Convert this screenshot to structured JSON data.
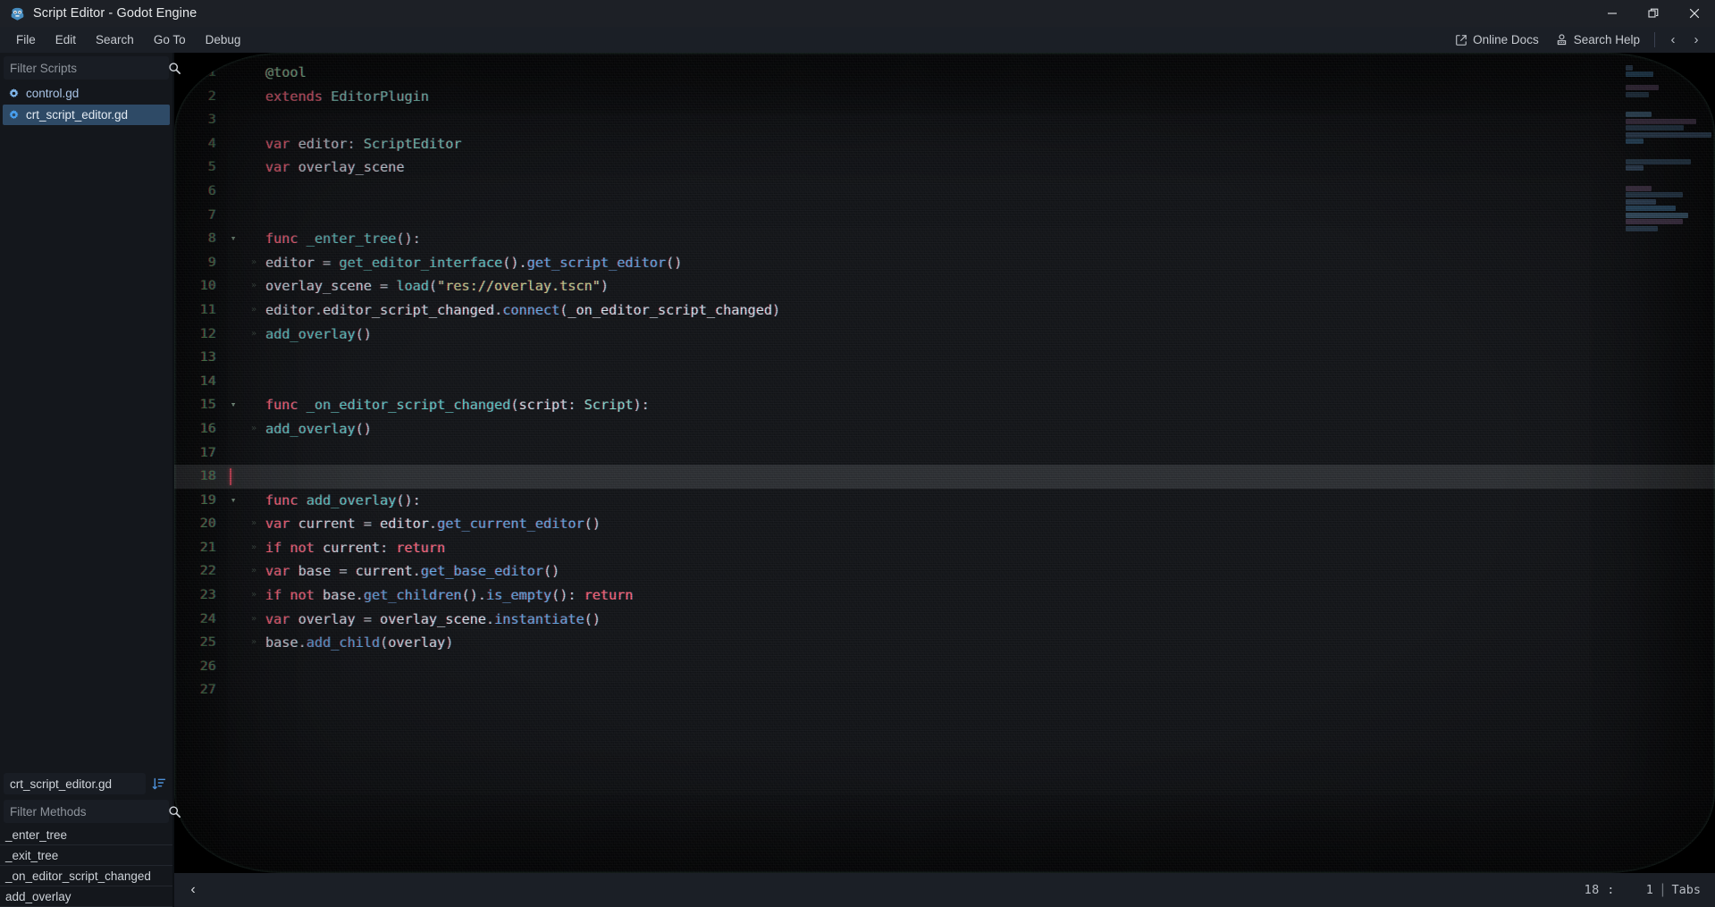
{
  "window": {
    "title": "Script Editor - Godot Engine",
    "app_icon": "godot-logo-icon",
    "controls": {
      "minimize": "minimize-icon",
      "restore": "restore-icon",
      "close": "close-icon"
    }
  },
  "menubar": {
    "items": [
      {
        "label": "File"
      },
      {
        "label": "Edit"
      },
      {
        "label": "Search"
      },
      {
        "label": "Go To"
      },
      {
        "label": "Debug"
      }
    ],
    "right": {
      "online_docs": "Online Docs",
      "search_help": "Search Help",
      "nav_prev": "‹",
      "nav_next": "›"
    }
  },
  "sidebar": {
    "filter_scripts": {
      "placeholder": "Filter Scripts",
      "value": "",
      "icon": "search-icon"
    },
    "scripts": [
      {
        "name": "control.gd",
        "icon": "gear-icon",
        "selected": false
      },
      {
        "name": "crt_script_editor.gd",
        "icon": "gear-icon",
        "selected": true
      }
    ],
    "current_file": "crt_script_editor.gd",
    "sort_button": "sort-icon",
    "filter_methods": {
      "placeholder": "Filter Methods",
      "value": "",
      "icon": "search-icon"
    },
    "methods": [
      {
        "name": "_enter_tree"
      },
      {
        "name": "_exit_tree"
      },
      {
        "name": "_on_editor_script_changed"
      },
      {
        "name": "add_overlay"
      }
    ]
  },
  "editor": {
    "active_line": 18,
    "lines": [
      {
        "n": 1,
        "fold": "",
        "guide": "",
        "tokens": [
          {
            "t": "annot",
            "s": "@tool"
          }
        ]
      },
      {
        "n": 2,
        "fold": "",
        "guide": "",
        "tokens": [
          {
            "t": "kw",
            "s": "extends"
          },
          {
            "t": "punc",
            "s": " "
          },
          {
            "t": "type",
            "s": "EditorPlugin"
          }
        ]
      },
      {
        "n": 3,
        "fold": "",
        "guide": "",
        "tokens": []
      },
      {
        "n": 4,
        "fold": "",
        "guide": "",
        "tokens": [
          {
            "t": "kw",
            "s": "var"
          },
          {
            "t": "punc",
            "s": " "
          },
          {
            "t": "var",
            "s": "editor"
          },
          {
            "t": "punc",
            "s": ": "
          },
          {
            "t": "type",
            "s": "ScriptEditor"
          }
        ]
      },
      {
        "n": 5,
        "fold": "",
        "guide": "",
        "tokens": [
          {
            "t": "kw",
            "s": "var"
          },
          {
            "t": "punc",
            "s": " "
          },
          {
            "t": "var",
            "s": "overlay_scene"
          }
        ]
      },
      {
        "n": 6,
        "fold": "",
        "guide": "",
        "tokens": []
      },
      {
        "n": 7,
        "fold": "",
        "guide": "",
        "tokens": []
      },
      {
        "n": 8,
        "fold": "v",
        "guide": "",
        "tokens": [
          {
            "t": "kw",
            "s": "func"
          },
          {
            "t": "punc",
            "s": " "
          },
          {
            "t": "fn",
            "s": "_enter_tree"
          },
          {
            "t": "punc",
            "s": "():"
          }
        ]
      },
      {
        "n": 9,
        "fold": "",
        "guide": "»",
        "tokens": [
          {
            "t": "var",
            "s": "editor"
          },
          {
            "t": "punc",
            "s": " = "
          },
          {
            "t": "fn",
            "s": "get_editor_interface"
          },
          {
            "t": "punc",
            "s": "()."
          },
          {
            "t": "member",
            "s": "get_script_editor"
          },
          {
            "t": "punc",
            "s": "()"
          }
        ]
      },
      {
        "n": 10,
        "fold": "",
        "guide": "»",
        "tokens": [
          {
            "t": "var",
            "s": "overlay_scene"
          },
          {
            "t": "punc",
            "s": " = "
          },
          {
            "t": "fn",
            "s": "load"
          },
          {
            "t": "punc",
            "s": "("
          },
          {
            "t": "str",
            "s": "\"res://overlay.tscn\""
          },
          {
            "t": "punc",
            "s": ")"
          }
        ]
      },
      {
        "n": 11,
        "fold": "",
        "guide": "»",
        "tokens": [
          {
            "t": "var",
            "s": "editor"
          },
          {
            "t": "punc",
            "s": "."
          },
          {
            "t": "var",
            "s": "editor_script_changed"
          },
          {
            "t": "punc",
            "s": "."
          },
          {
            "t": "member",
            "s": "connect"
          },
          {
            "t": "punc",
            "s": "("
          },
          {
            "t": "var",
            "s": "_on_editor_script_changed"
          },
          {
            "t": "punc",
            "s": ")"
          }
        ]
      },
      {
        "n": 12,
        "fold": "",
        "guide": "»",
        "tokens": [
          {
            "t": "fn",
            "s": "add_overlay"
          },
          {
            "t": "punc",
            "s": "()"
          }
        ]
      },
      {
        "n": 13,
        "fold": "",
        "guide": "",
        "tokens": []
      },
      {
        "n": 14,
        "fold": "",
        "guide": "",
        "tokens": []
      },
      {
        "n": 15,
        "fold": "v",
        "guide": "",
        "tokens": [
          {
            "t": "kw",
            "s": "func"
          },
          {
            "t": "punc",
            "s": " "
          },
          {
            "t": "fn",
            "s": "_on_editor_script_changed"
          },
          {
            "t": "punc",
            "s": "("
          },
          {
            "t": "var",
            "s": "script"
          },
          {
            "t": "punc",
            "s": ": "
          },
          {
            "t": "type",
            "s": "Script"
          },
          {
            "t": "punc",
            "s": "):"
          }
        ]
      },
      {
        "n": 16,
        "fold": "",
        "guide": "»",
        "tokens": [
          {
            "t": "fn",
            "s": "add_overlay"
          },
          {
            "t": "punc",
            "s": "()"
          }
        ]
      },
      {
        "n": 17,
        "fold": "",
        "guide": "",
        "tokens": []
      },
      {
        "n": 18,
        "fold": "",
        "guide": "",
        "tokens": []
      },
      {
        "n": 19,
        "fold": "v",
        "guide": "",
        "tokens": [
          {
            "t": "kw",
            "s": "func"
          },
          {
            "t": "punc",
            "s": " "
          },
          {
            "t": "fn",
            "s": "add_overlay"
          },
          {
            "t": "punc",
            "s": "():"
          }
        ]
      },
      {
        "n": 20,
        "fold": "",
        "guide": "»",
        "tokens": [
          {
            "t": "kw",
            "s": "var"
          },
          {
            "t": "punc",
            "s": " "
          },
          {
            "t": "var",
            "s": "current"
          },
          {
            "t": "punc",
            "s": " = "
          },
          {
            "t": "var",
            "s": "editor"
          },
          {
            "t": "punc",
            "s": "."
          },
          {
            "t": "member",
            "s": "get_current_editor"
          },
          {
            "t": "punc",
            "s": "()"
          }
        ]
      },
      {
        "n": 21,
        "fold": "",
        "guide": "»",
        "tokens": [
          {
            "t": "kw",
            "s": "if"
          },
          {
            "t": "punc",
            "s": " "
          },
          {
            "t": "kw",
            "s": "not"
          },
          {
            "t": "punc",
            "s": " "
          },
          {
            "t": "var",
            "s": "current"
          },
          {
            "t": "punc",
            "s": ": "
          },
          {
            "t": "kw",
            "s": "return"
          }
        ]
      },
      {
        "n": 22,
        "fold": "",
        "guide": "»",
        "tokens": [
          {
            "t": "kw",
            "s": "var"
          },
          {
            "t": "punc",
            "s": " "
          },
          {
            "t": "var",
            "s": "base"
          },
          {
            "t": "punc",
            "s": " = "
          },
          {
            "t": "var",
            "s": "current"
          },
          {
            "t": "punc",
            "s": "."
          },
          {
            "t": "member",
            "s": "get_base_editor"
          },
          {
            "t": "punc",
            "s": "()"
          }
        ]
      },
      {
        "n": 23,
        "fold": "",
        "guide": "»",
        "tokens": [
          {
            "t": "kw",
            "s": "if"
          },
          {
            "t": "punc",
            "s": " "
          },
          {
            "t": "kw",
            "s": "not"
          },
          {
            "t": "punc",
            "s": " "
          },
          {
            "t": "var",
            "s": "base"
          },
          {
            "t": "punc",
            "s": "."
          },
          {
            "t": "member",
            "s": "get_children"
          },
          {
            "t": "punc",
            "s": "()."
          },
          {
            "t": "member",
            "s": "is_empty"
          },
          {
            "t": "punc",
            "s": "(): "
          },
          {
            "t": "kw",
            "s": "return"
          }
        ]
      },
      {
        "n": 24,
        "fold": "",
        "guide": "»",
        "tokens": [
          {
            "t": "kw",
            "s": "var"
          },
          {
            "t": "punc",
            "s": " "
          },
          {
            "t": "var",
            "s": "overlay"
          },
          {
            "t": "punc",
            "s": " = "
          },
          {
            "t": "var",
            "s": "overlay_scene"
          },
          {
            "t": "punc",
            "s": "."
          },
          {
            "t": "member",
            "s": "instantiate"
          },
          {
            "t": "punc",
            "s": "()"
          }
        ]
      },
      {
        "n": 25,
        "fold": "",
        "guide": "»",
        "tokens": [
          {
            "t": "var",
            "s": "base"
          },
          {
            "t": "punc",
            "s": "."
          },
          {
            "t": "member",
            "s": "add_child"
          },
          {
            "t": "punc",
            "s": "("
          },
          {
            "t": "var",
            "s": "overlay"
          },
          {
            "t": "punc",
            "s": ")"
          }
        ]
      },
      {
        "n": 26,
        "fold": "",
        "guide": "",
        "tokens": []
      },
      {
        "n": 27,
        "fold": "",
        "guide": "",
        "tokens": []
      }
    ]
  },
  "statusbar": {
    "back_button": "‹",
    "line": "18",
    "colon": ":",
    "column": "1",
    "separator": "|",
    "indent_mode": "Tabs"
  },
  "colors": {
    "accent": "#4d90d8",
    "selected_row": "#2e4a66",
    "keyword": "#ff6b7e",
    "function": "#63d0c8",
    "string": "#c8d08a",
    "linenumber": "#4e7f50",
    "member": "#68a8e6"
  }
}
